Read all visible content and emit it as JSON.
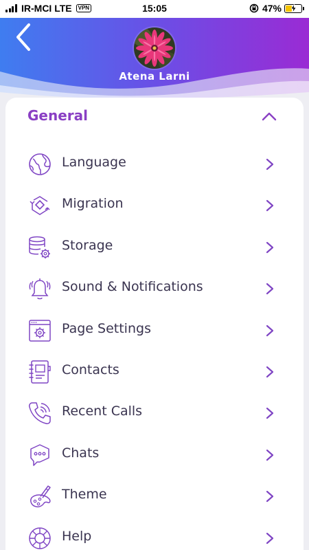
{
  "status_bar": {
    "carrier": "IR-MCI LTE",
    "vpn": "VPN",
    "time": "15:05",
    "battery_percent": "47%",
    "battery_level": 0.47
  },
  "header": {
    "user_name": "Atena Larni",
    "gradient_start": "#3f7df0",
    "gradient_end": "#9a2bd4"
  },
  "section": {
    "title": "General",
    "accent_color": "#8a3fc4"
  },
  "items": [
    {
      "label": "Language",
      "icon": "globe-icon"
    },
    {
      "label": "Migration",
      "icon": "migration-icon"
    },
    {
      "label": "Storage",
      "icon": "storage-icon"
    },
    {
      "label": "Sound & Notifications",
      "icon": "bell-icon"
    },
    {
      "label": "Page Settings",
      "icon": "page-settings-icon"
    },
    {
      "label": "Contacts",
      "icon": "contacts-icon"
    },
    {
      "label": "Recent Calls",
      "icon": "phone-icon"
    },
    {
      "label": "Chats",
      "icon": "chat-icon"
    },
    {
      "label": "Theme",
      "icon": "palette-icon"
    },
    {
      "label": "Help",
      "icon": "help-icon"
    }
  ]
}
